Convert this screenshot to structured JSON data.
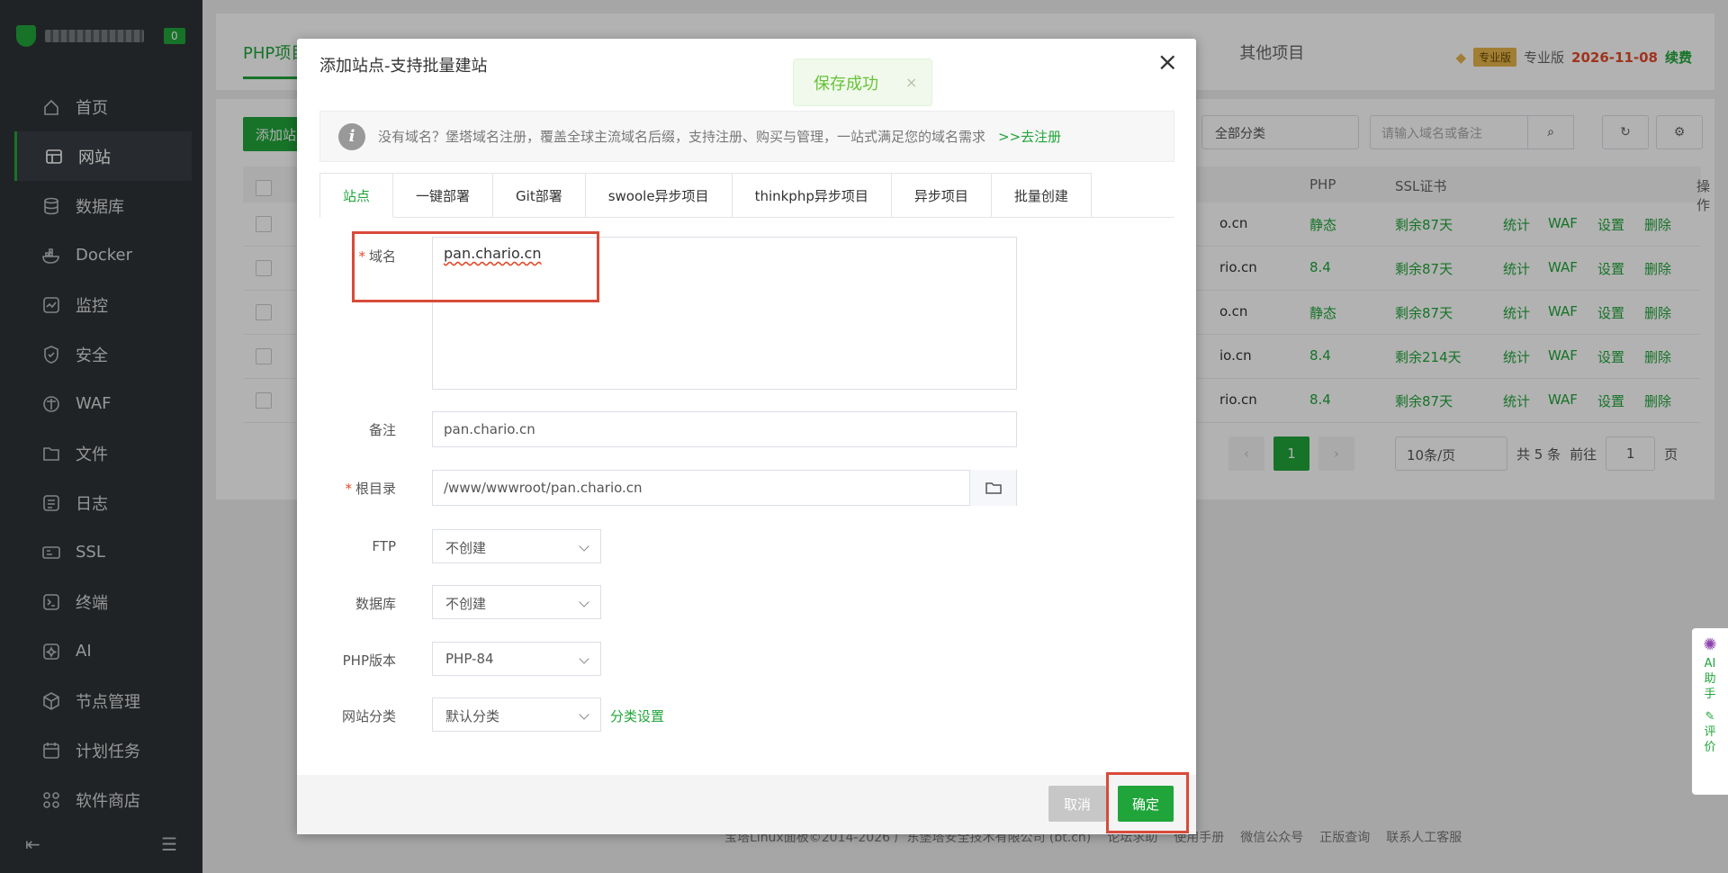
{
  "sidebar": {
    "badge": "0",
    "items": [
      {
        "label": "首页",
        "icon": "home-icon"
      },
      {
        "label": "网站",
        "icon": "website-icon"
      },
      {
        "label": "数据库",
        "icon": "database-icon"
      },
      {
        "label": "Docker",
        "icon": "docker-icon"
      },
      {
        "label": "监控",
        "icon": "monitor-icon"
      },
      {
        "label": "安全",
        "icon": "shield-icon"
      },
      {
        "label": "WAF",
        "icon": "waf-icon"
      },
      {
        "label": "文件",
        "icon": "folder-icon"
      },
      {
        "label": "日志",
        "icon": "log-icon"
      },
      {
        "label": "SSL",
        "icon": "ssl-icon"
      },
      {
        "label": "终端",
        "icon": "terminal-icon"
      },
      {
        "label": "AI",
        "icon": "ai-icon"
      },
      {
        "label": "节点管理",
        "icon": "node-icon"
      },
      {
        "label": "计划任务",
        "icon": "calendar-icon"
      },
      {
        "label": "软件商店",
        "icon": "apps-icon"
      }
    ],
    "active_index": 1
  },
  "topbar": {
    "active_tab": "PHP项目",
    "tabs_behind": [
      "其他项目"
    ],
    "pro_tag": "专业版",
    "pro_label": "专业版",
    "expire_date": "2026-11-08",
    "renew": "续费"
  },
  "background_page": {
    "add_button": "添加站",
    "category_select": "全部分类",
    "search_placeholder": "请输入域名或备注",
    "columns": {
      "php": "PHP",
      "ssl": "SSL证书",
      "ops": "操作"
    },
    "rows": [
      {
        "domain_suffix": "o.cn",
        "php": "静态",
        "ssl": "剩余87天"
      },
      {
        "domain_suffix": "rio.cn",
        "php": "8.4",
        "ssl": "剩余87天"
      },
      {
        "domain_suffix": "o.cn",
        "php": "静态",
        "ssl": "剩余87天"
      },
      {
        "domain_suffix": "io.cn",
        "php": "8.4",
        "ssl": "剩余214天"
      },
      {
        "domain_suffix": "rio.cn",
        "php": "8.4",
        "ssl": "剩余87天"
      }
    ],
    "row_actions": [
      "统计",
      "WAF",
      "设置",
      "删除"
    ],
    "pager": {
      "current": "1",
      "page_size": "10条/页",
      "total": "共 5 条",
      "goto": "前往",
      "goto_value": "1",
      "page_unit": "页"
    },
    "footer": [
      "宝塔Linux面板©2014-2026 广东堡塔安全技术有限公司 (bt.cn)",
      "论坛求助",
      "使用手册",
      "微信公众号",
      "正版查询",
      "联系人工客服"
    ]
  },
  "toast": {
    "message": "保存成功",
    "close": "×"
  },
  "dialog": {
    "title": "添加站点-支持批量建站",
    "close": "×",
    "notice": "没有域名？堡塔域名注册，覆盖全球主流域名后缀，支持注册、购买与管理，一站式满足您的域名需求",
    "notice_link": ">>去注册",
    "tabs": [
      "站点",
      "一键部署",
      "Git部署",
      "swoole异步项目",
      "thinkphp异步项目",
      "异步项目",
      "批量创建"
    ],
    "form": {
      "domain_label": "域名",
      "domain_value": "pan.chario.cn",
      "remark_label": "备注",
      "remark_value": "pan.chario.cn",
      "root_label": "根目录",
      "root_value": "/www/wwwroot/pan.chario.cn",
      "ftp_label": "FTP",
      "ftp_value": "不创建",
      "db_label": "数据库",
      "db_value": "不创建",
      "php_label": "PHP版本",
      "php_value": "PHP-84",
      "category_label": "网站分类",
      "category_value": "默认分类",
      "category_link": "分类设置"
    },
    "cancel": "取消",
    "confirm": "确定"
  },
  "ai_helper": {
    "label": "AI助手",
    "review": "评价"
  }
}
